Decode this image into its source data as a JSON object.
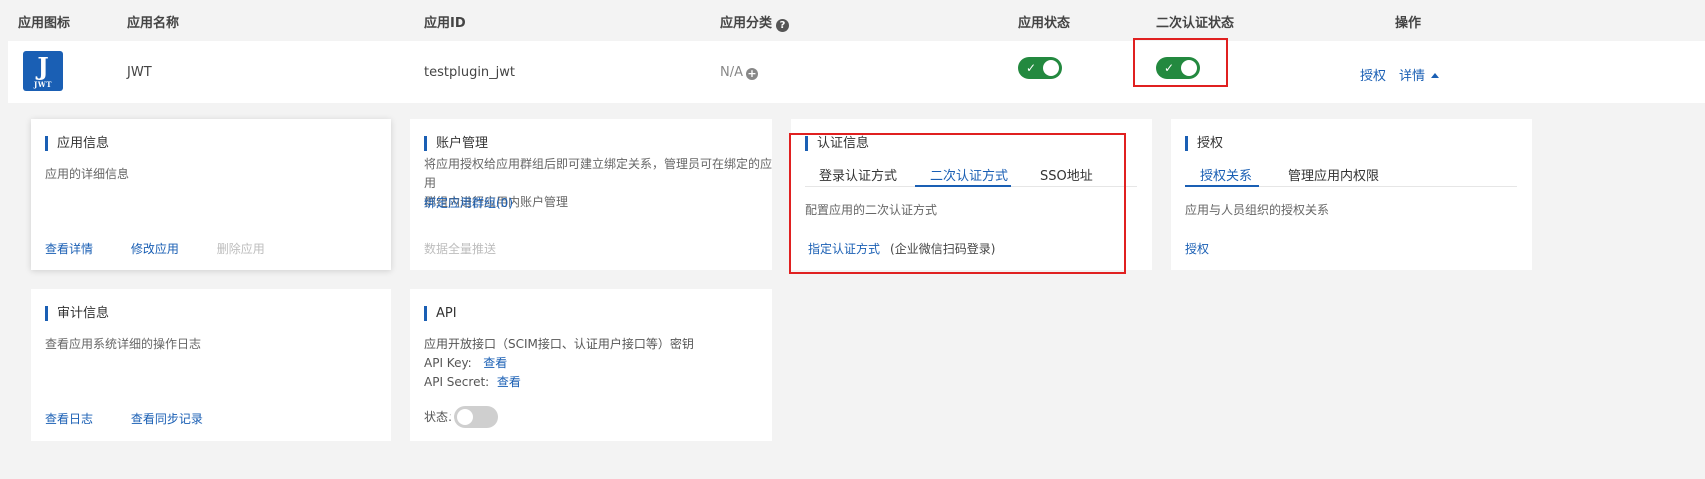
{
  "table_header": {
    "icon": "应用图标",
    "name": "应用名称",
    "id": "应用ID",
    "category": "应用分类",
    "status": "应用状态",
    "mfa_status": "二次认证状态",
    "actions": "操作"
  },
  "app_row": {
    "icon_letter": "J",
    "icon_subtext": "JWT",
    "name": "JWT",
    "app_id": "testplugin_jwt",
    "category": "N/A",
    "status_on": true,
    "mfa_on": true,
    "action_authorize": "授权",
    "action_details": "详情"
  },
  "cards": {
    "app_info": {
      "title": "应用信息",
      "desc": "应用的详细信息",
      "links": [
        "查看详情",
        "修改应用"
      ],
      "disabled_link": "删除应用"
    },
    "account": {
      "title": "账户管理",
      "desc_line1": "将应用授权给应用群组后即可建立绑定关系，管理员可在绑定的应用",
      "desc_line2": "群组内进行应用内账户管理",
      "bind_link": "绑定应用群组(0)",
      "disabled_link": "数据全量推送"
    },
    "auth": {
      "title": "认证信息",
      "tabs": [
        "登录认证方式",
        "二次认证方式",
        "SSO地址"
      ],
      "active_tab": 1,
      "desc": "配置应用的二次认证方式",
      "link": "指定认证方式",
      "method": "(企业微信扫码登录)"
    },
    "grant": {
      "title": "授权",
      "tabs": [
        "授权关系",
        "管理应用内权限"
      ],
      "active_tab": 0,
      "desc": "应用与人员组织的授权关系",
      "link": "授权"
    },
    "audit": {
      "title": "审计信息",
      "desc": "查看应用系统详细的操作日志",
      "links": [
        "查看日志",
        "查看同步记录"
      ]
    },
    "api": {
      "title": "API",
      "desc": "应用开放接口（SCIM接口、认证用户接口等）密钥",
      "key_label": "API Key:",
      "key_link": "查看",
      "secret_label": "API Secret:",
      "secret_link": "查看",
      "status_label": "状态:",
      "status_on": false
    }
  },
  "colors": {
    "accent": "#1a5fb4",
    "toggle_on": "#23893f",
    "highlight": "#e02020"
  }
}
